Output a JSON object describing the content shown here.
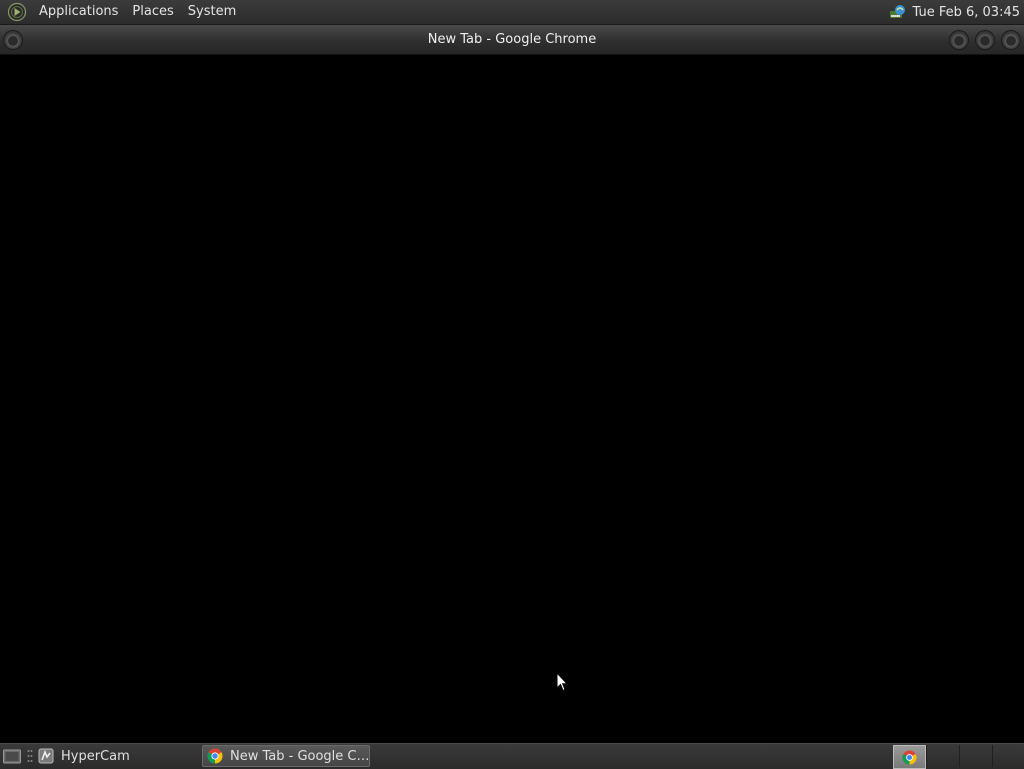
{
  "top_panel": {
    "logo_icon": "menu-logo-icon",
    "menu": [
      "Applications",
      "Places",
      "System"
    ],
    "network_icon": "network-status-icon",
    "clock": "Tue Feb  6, 03:45"
  },
  "window": {
    "title": "New Tab - Google Chrome",
    "controls": [
      "menu-button",
      "minimize-button",
      "maximize-button",
      "close-button"
    ]
  },
  "taskbar": {
    "show_desktop_icon": "show-desktop-icon",
    "tasks": [
      {
        "label": "HyperCam",
        "icon": "hypercam-icon",
        "active": false
      },
      {
        "label": "New Tab - Google C…",
        "icon": "chrome-icon",
        "active": true
      }
    ],
    "workspaces": {
      "count": 4,
      "selected": 1,
      "selected_icon": "chrome-icon"
    }
  },
  "colors": {
    "panel": "#2f2f2f",
    "desktop": "#000000",
    "active_task": "#4e4e4e",
    "workspace_selected": "#8a8a8a"
  }
}
